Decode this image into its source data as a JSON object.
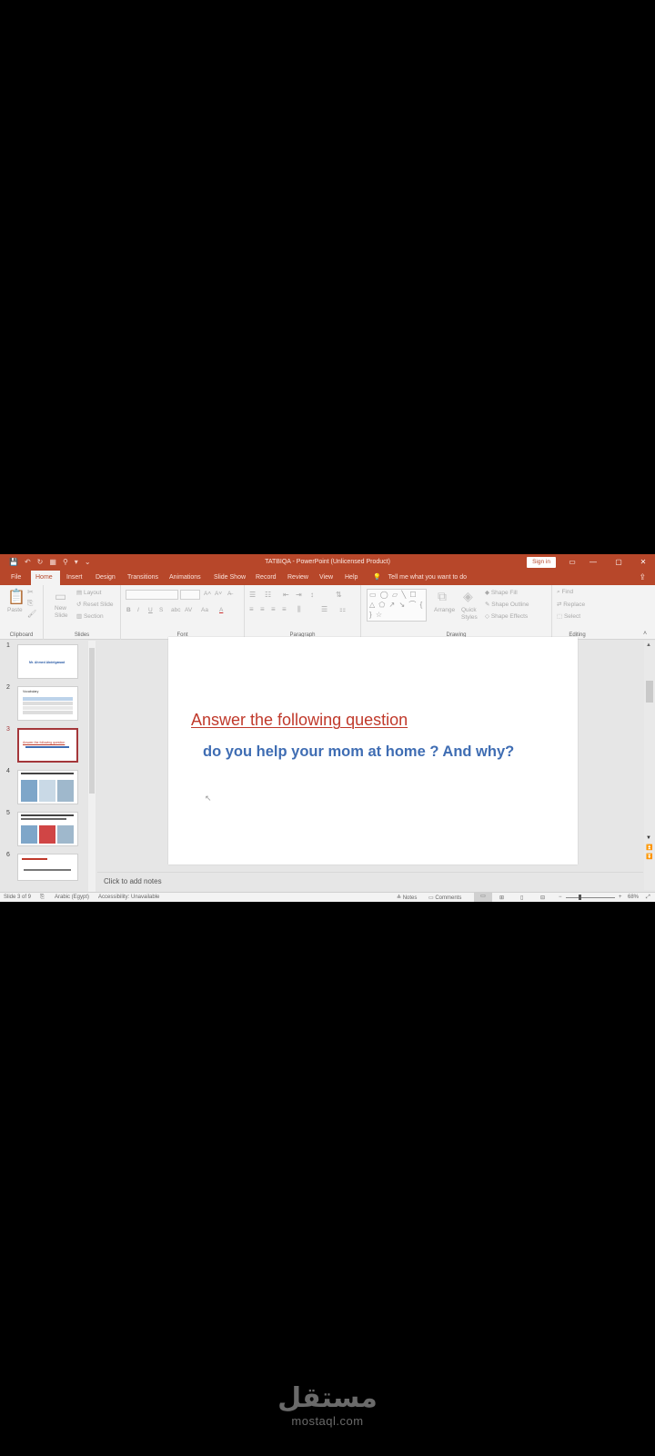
{
  "app": {
    "doc_title": "TATBIQA - PowerPoint (Unlicensed Product)",
    "sign_in": "Sign in",
    "window_buttons": [
      "▭",
      "—",
      "▢",
      "✕"
    ]
  },
  "qat": [
    "💾",
    "↶",
    "↻",
    "▦",
    "⚲",
    "▾",
    "⌄"
  ],
  "tabs": [
    "File",
    "Home",
    "Insert",
    "Design",
    "Transitions",
    "Animations",
    "Slide Show",
    "Record",
    "Review",
    "View",
    "Help"
  ],
  "active_tab": "Home",
  "tell_me": "Tell me what you want to do",
  "ribbon": {
    "clipboard": {
      "label": "Clipboard",
      "paste": "Paste"
    },
    "slides": {
      "label": "Slides",
      "new_slide": "New Slide",
      "layout": "Layout",
      "reset": "Reset Slide",
      "section": "Section"
    },
    "font": {
      "label": "Font",
      "bold": "B",
      "italic": "I",
      "underline": "U",
      "strike": "S",
      "grow": "A˄",
      "shrink": "A˅",
      "clear": "A̶",
      "spacing": "AV",
      "case": "Aa",
      "color": "A"
    },
    "paragraph": {
      "label": "Paragraph"
    },
    "drawing": {
      "label": "Drawing",
      "arrange": "Arrange",
      "quick_styles": "Quick Styles",
      "shape_fill": "Shape Fill",
      "shape_outline": "Shape Outline",
      "shape_effects": "Shape Effects",
      "shapes_glyphs": "▭ ◯ ▱ ╲ ☐ △ ⬠ ↗ ↘ ⌒ { } ☆"
    },
    "editing": {
      "label": "Editing",
      "find": "Find",
      "replace": "Replace",
      "select": "Select"
    }
  },
  "thumbnails": [
    {
      "num": "1",
      "text": "Mr. Ahmed Abdelgawad"
    },
    {
      "num": "2",
      "text": "Vocabulary"
    },
    {
      "num": "3",
      "text": "Answer the following question"
    },
    {
      "num": "4",
      "text": ""
    },
    {
      "num": "5",
      "text": ""
    },
    {
      "num": "6",
      "text": ""
    }
  ],
  "slide": {
    "heading": "Answer the following question",
    "question": "do you help your mom at home ? And why?"
  },
  "notes_placeholder": "Click to add notes",
  "status": {
    "slide_count": "Slide 3 of 9",
    "language": "Arabic (Egypt)",
    "accessibility": "Accessibility: Unavailable",
    "notes": "Notes",
    "comments": "Comments",
    "zoom": "68%"
  },
  "watermark": {
    "arabic": "مستقل",
    "latin": "mostaql.com"
  },
  "colors": {
    "title_bar": "#b7472a",
    "heading": "#c0392b",
    "question": "#3f6db3"
  }
}
